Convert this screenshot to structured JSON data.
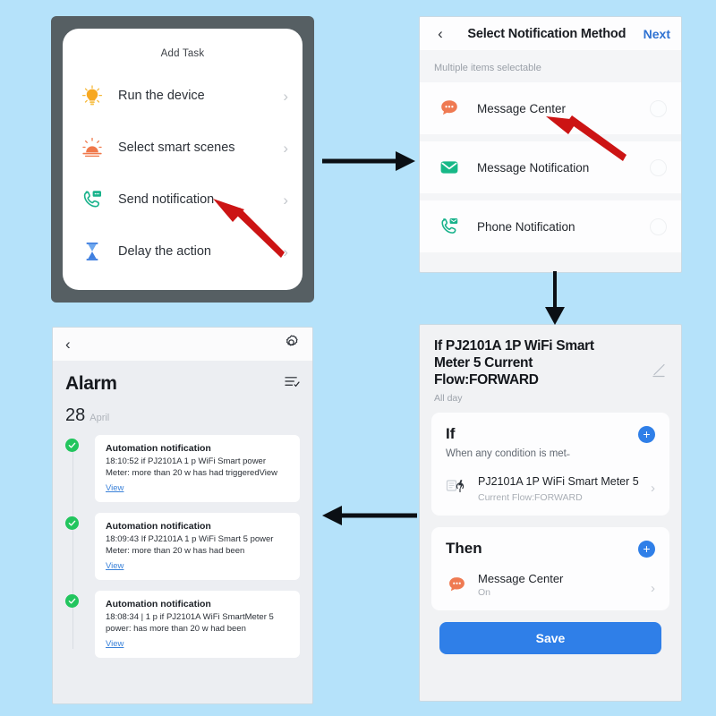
{
  "theme": {
    "background": "#b5e2fa",
    "accent_blue": "#2f7fe8",
    "link_blue": "#3b82d9",
    "green": "#22c55e",
    "red_arrow": "#cc1414",
    "phone_frame": "#565f63"
  },
  "panel_add_task": {
    "title": "Add Task",
    "items": [
      {
        "label": "Run the device",
        "icon": "lightbulb-icon",
        "chevron": "›"
      },
      {
        "label": "Select smart scenes",
        "icon": "sunrise-scene-icon",
        "chevron": "›"
      },
      {
        "label": "Send notification",
        "icon": "phone-message-icon",
        "chevron": "›"
      },
      {
        "label": "Delay the action",
        "icon": "hourglass-icon",
        "chevron": "›"
      }
    ]
  },
  "panel_notification_method": {
    "back_icon": "‹",
    "title": "Select Notification Method",
    "next_label": "Next",
    "hint": "Multiple items selectable",
    "options": [
      {
        "label": "Message Center",
        "icon": "chat-bubble-icon",
        "selected": false
      },
      {
        "label": "Message Notification",
        "icon": "envelope-icon",
        "selected": false
      },
      {
        "label": "Phone Notification",
        "icon": "phone-message-icon",
        "selected": false
      }
    ]
  },
  "panel_automation_detail": {
    "title": "If PJ2101A 1P WiFi Smart Meter  5 Current Flow:FORWARD",
    "subtitle": "All day",
    "edit_icon": "pencil-icon",
    "if_card": {
      "keyword": "If",
      "add_icon": "plus-icon",
      "condition_mode": "When any condition is met˗",
      "device_name": "PJ2101A 1P WiFi Smart Meter 5",
      "device_state": "Current Flow:FORWARD",
      "device_icon": "smart-meter-icon",
      "chevron": "›"
    },
    "then_card": {
      "keyword": "Then",
      "add_icon": "plus-icon",
      "action_name": "Message Center",
      "action_state": "On",
      "action_icon": "chat-bubble-icon",
      "chevron": "›"
    },
    "save_label": "Save"
  },
  "panel_alarm": {
    "back_icon": "‹",
    "gear_icon": "gear-icon",
    "title": "Alarm",
    "filter_icon": "filter-list-icon",
    "date_day": "28",
    "date_month": "April",
    "notifications": [
      {
        "title": "Automation notification",
        "body": "18:10:52 if PJ2101A 1 p WiFi Smart power Meter: more than 20 w has had triggeredView",
        "link": "View"
      },
      {
        "title": "Automation notification",
        "body": "18:09:43 If PJ2101A 1 p WiFi Smart 5 power Meter: more than 20 w has had been",
        "link": "View"
      },
      {
        "title": "Automation notification",
        "body": "18:08:34 | 1 p if PJ2101A WiFi SmartMeter 5 power: has more than 20 w had been",
        "link": "View"
      }
    ]
  },
  "flow_arrows": [
    {
      "name": "arrow-addtask-to-method",
      "direction": "right"
    },
    {
      "name": "arrow-method-to-detail",
      "direction": "down"
    },
    {
      "name": "arrow-detail-to-alarm",
      "direction": "left"
    }
  ],
  "annotations": [
    {
      "name": "red-arrow-send-notification",
      "points_to": "Send notification"
    },
    {
      "name": "red-arrow-message-center",
      "points_to": "Message Center"
    }
  ]
}
